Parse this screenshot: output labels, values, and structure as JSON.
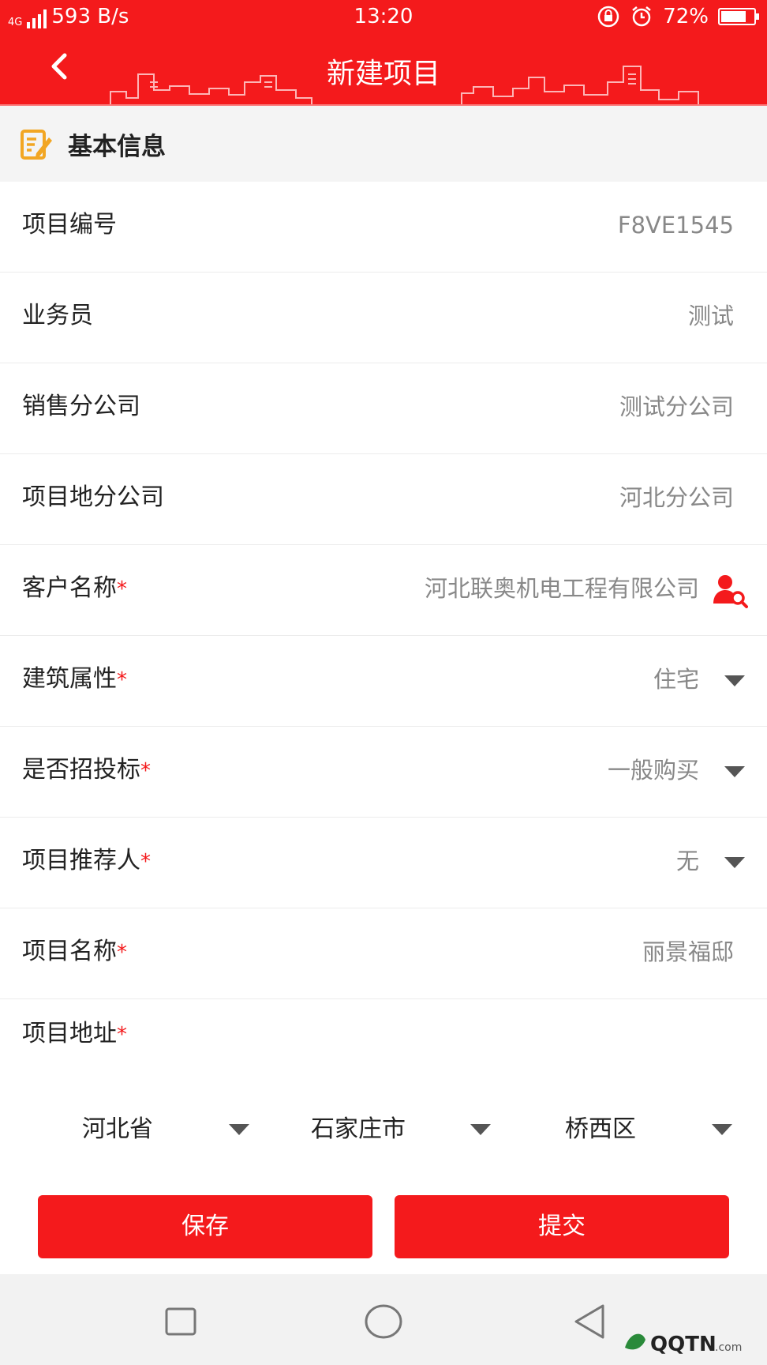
{
  "status_bar": {
    "network": "4G",
    "speed": "593 B/s",
    "time": "13:20",
    "battery": "72%"
  },
  "header": {
    "title": "新建项目",
    "back_icon": "chevron-left-icon"
  },
  "section": {
    "title": "基本信息",
    "icon": "edit-document-icon"
  },
  "fields": [
    {
      "label": "项目编号",
      "required": false,
      "value": "F8VE1545"
    },
    {
      "label": "业务员",
      "required": false,
      "value": "测试"
    },
    {
      "label": "销售分公司",
      "required": false,
      "value": "测试分公司"
    },
    {
      "label": "项目地分公司",
      "required": false,
      "value": "河北分公司"
    },
    {
      "label": "客户名称",
      "required": true,
      "value": "河北联奥机电工程有限公司",
      "icon": "user-search-icon"
    },
    {
      "label": "建筑属性",
      "required": true,
      "value": "住宅",
      "dropdown": true
    },
    {
      "label": "是否招投标",
      "required": true,
      "value": "一般购买",
      "dropdown": true
    },
    {
      "label": "项目推荐人",
      "required": true,
      "value": "无",
      "dropdown": true
    },
    {
      "label": "项目名称",
      "required": true,
      "value": "丽景福邸"
    }
  ],
  "required_mark": "*",
  "address": {
    "label": "项目地址",
    "required": true,
    "province": "河北省",
    "city": "石家庄市",
    "district": "桥西区"
  },
  "buttons": {
    "save": "保存",
    "submit": "提交"
  },
  "nav": {
    "recent": "square-icon",
    "home": "circle-icon",
    "back": "triangle-back-icon"
  },
  "watermark": "QQTN.com",
  "colors": {
    "accent": "#f41a1c",
    "value_text": "#888888",
    "label_text": "#222222"
  }
}
